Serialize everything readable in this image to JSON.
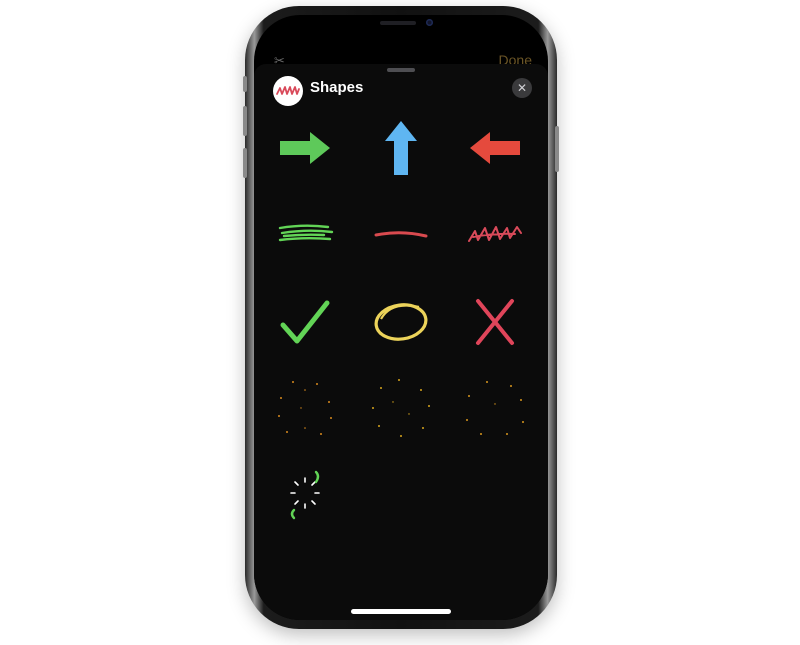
{
  "nav": {
    "done_label": "Done",
    "scissors_icon": "scissors-icon"
  },
  "sheet": {
    "title": "Shapes",
    "close_icon": "xmark-icon"
  },
  "shapes": [
    {
      "name": "right-arrow",
      "color": "#5ec95a"
    },
    {
      "name": "up-arrow",
      "color": "#5fb6f2"
    },
    {
      "name": "left-arrow",
      "color": "#e54a3d"
    },
    {
      "name": "green-scribble",
      "color": "#62d456"
    },
    {
      "name": "red-line",
      "color": "#d94a4f"
    },
    {
      "name": "red-zigzag-scribble",
      "color": "#d94a5a"
    },
    {
      "name": "checkmark",
      "color": "#62d456"
    },
    {
      "name": "circle",
      "color": "#ecd35a"
    },
    {
      "name": "x-mark",
      "color": "#e0455a"
    },
    {
      "name": "orange-sparkle-burst",
      "color": "#d88a1d"
    },
    {
      "name": "gold-sparkle-burst",
      "color": "#d8a51d"
    },
    {
      "name": "amber-sparkle-burst",
      "color": "#d8961d"
    },
    {
      "name": "spinning-sparkle",
      "color": "#ffffff",
      "accent": "#62d456"
    }
  ]
}
